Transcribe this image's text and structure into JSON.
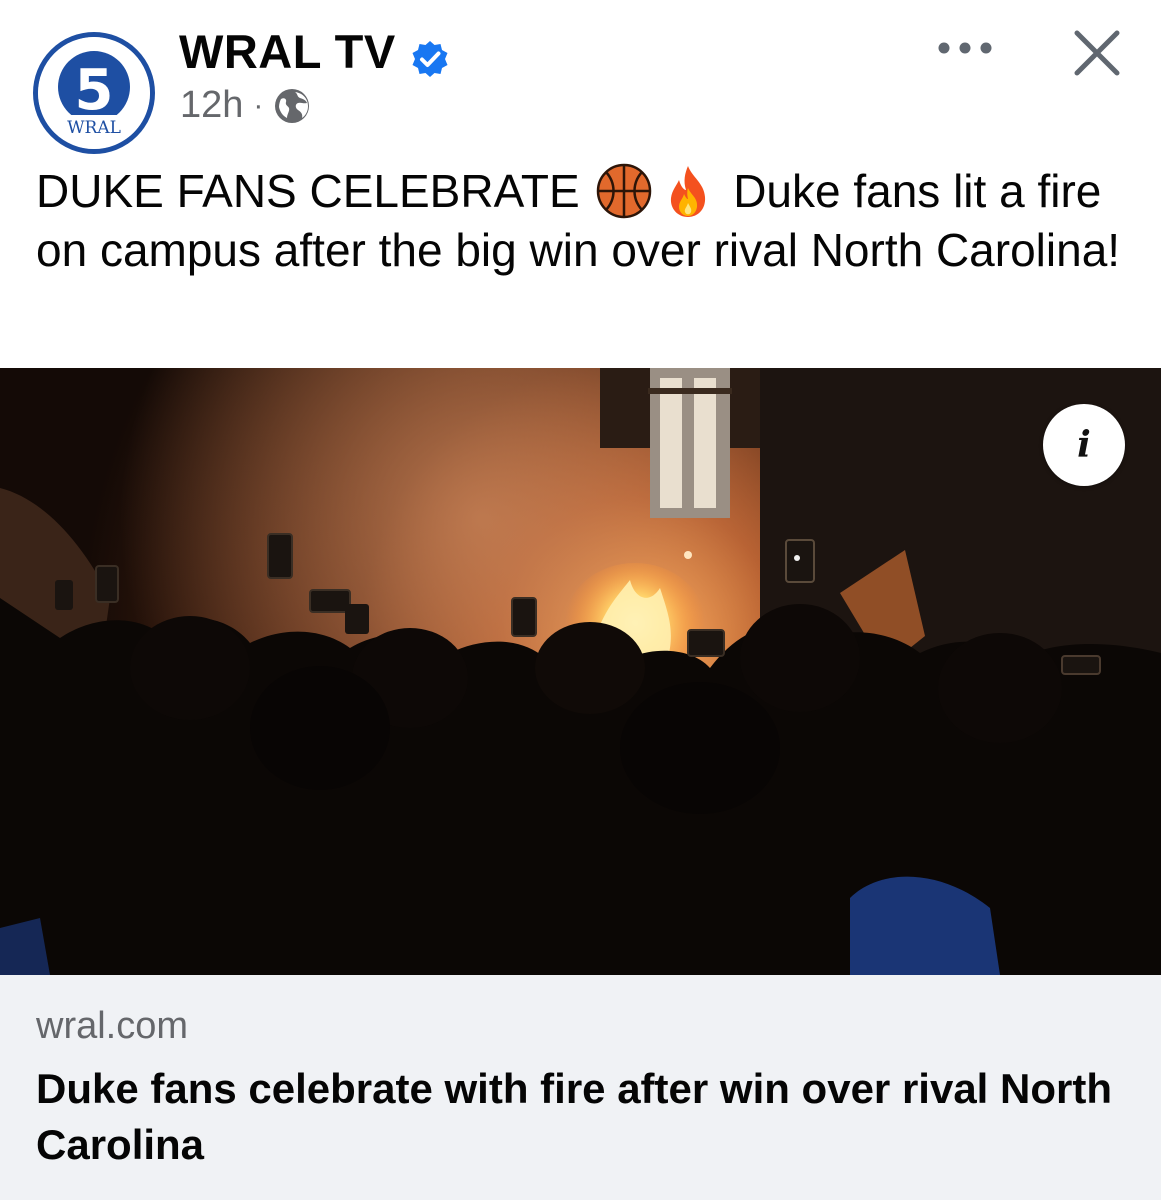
{
  "header": {
    "page_name": "WRAL TV",
    "avatar_number": "5",
    "avatar_brand": "WRAL",
    "timestamp": "12h",
    "separator": "·",
    "audience_icon": "globe-icon",
    "verified_icon": "verified-badge-icon",
    "more_icon": "more-horizontal-icon",
    "close_icon": "close-icon"
  },
  "post": {
    "text_part1": "DUKE FANS CELEBRATE",
    "emoji_1": "basketball-emoji",
    "emoji_2": "fire-emoji",
    "text_part2": "Duke fans lit a fire on campus after the big win over rival North Carolina!"
  },
  "media": {
    "info_label": "i"
  },
  "link_preview": {
    "domain": "wral.com",
    "title": "Duke fans celebrate with fire after win over rival North Carolina"
  },
  "colors": {
    "verified": "#1877f2",
    "avatar_ring": "#1e4fa3",
    "secondary_text": "#65676b",
    "card_background": "#f0f2f5"
  }
}
